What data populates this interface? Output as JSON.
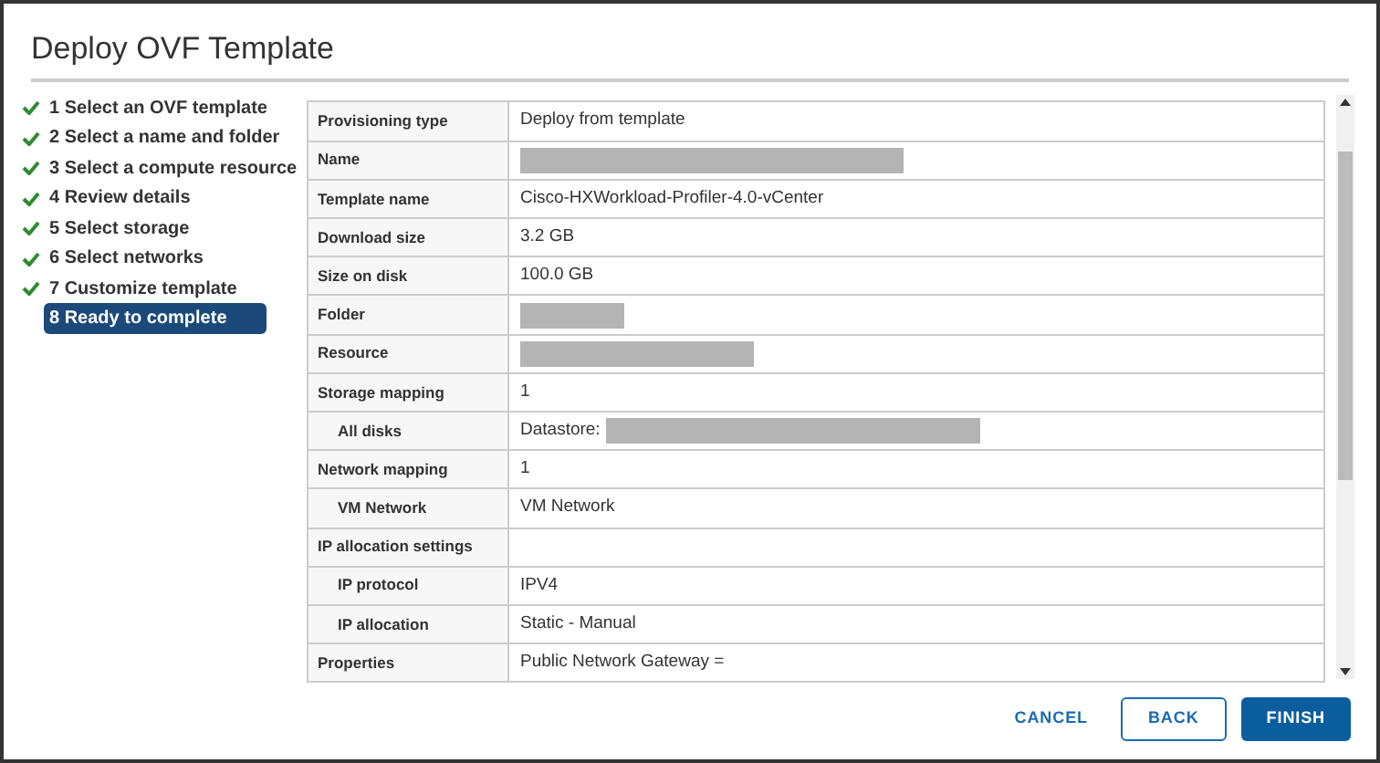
{
  "window": {
    "title": "Deploy OVF Template"
  },
  "steps": [
    {
      "label": "1 Select an OVF template",
      "done": true,
      "selected": false
    },
    {
      "label": "2 Select a name and folder",
      "done": true,
      "selected": false
    },
    {
      "label": "3 Select a compute resource",
      "done": true,
      "selected": false
    },
    {
      "label": "4 Review details",
      "done": true,
      "selected": false
    },
    {
      "label": "5 Select storage",
      "done": true,
      "selected": false
    },
    {
      "label": "6 Select networks",
      "done": true,
      "selected": false
    },
    {
      "label": "7 Customize template",
      "done": true,
      "selected": false
    },
    {
      "label": "8 Ready to complete",
      "done": false,
      "selected": true
    }
  ],
  "table": {
    "rows": [
      {
        "label": "Provisioning type",
        "value": "Deploy from template",
        "indented": false,
        "redacted": false
      },
      {
        "label": "Name",
        "indented": false,
        "redacted": true
      },
      {
        "label": "Template name",
        "value": "Cisco-HXWorkload-Profiler-4.0-vCenter",
        "indented": false,
        "redacted": false
      },
      {
        "label": "Download size",
        "value": "3.2 GB",
        "indented": false,
        "redacted": false
      },
      {
        "label": "Size on disk",
        "value": "100.0 GB",
        "indented": false,
        "redacted": false
      },
      {
        "label": "Folder",
        "indented": false,
        "redacted": true
      },
      {
        "label": "Resource",
        "indented": false,
        "redacted": true
      },
      {
        "label": "Storage mapping",
        "value": "1",
        "indented": false,
        "redacted": false
      },
      {
        "label": "All disks",
        "value": "Datastore:",
        "indented": true,
        "redacted": true
      },
      {
        "label": "Network mapping",
        "value": "1",
        "indented": false,
        "redacted": false
      },
      {
        "label": "VM Network",
        "value": "VM Network",
        "indented": true,
        "redacted": false
      },
      {
        "label": "IP allocation settings",
        "indented": false,
        "redacted": false
      },
      {
        "label": "IP protocol",
        "value": "IPV4",
        "indented": true,
        "redacted": false
      },
      {
        "label": "IP allocation",
        "value": "Static - Manual",
        "indented": true,
        "redacted": false
      },
      {
        "label": "Properties",
        "value": "Public Network Gateway =",
        "indented": false,
        "redacted": false
      }
    ]
  },
  "buttons": [
    {
      "label": "CANCEL",
      "kind": "flat"
    },
    {
      "label": "BACK",
      "kind": "outline"
    },
    {
      "label": "FINISH",
      "kind": "primary"
    }
  ]
}
